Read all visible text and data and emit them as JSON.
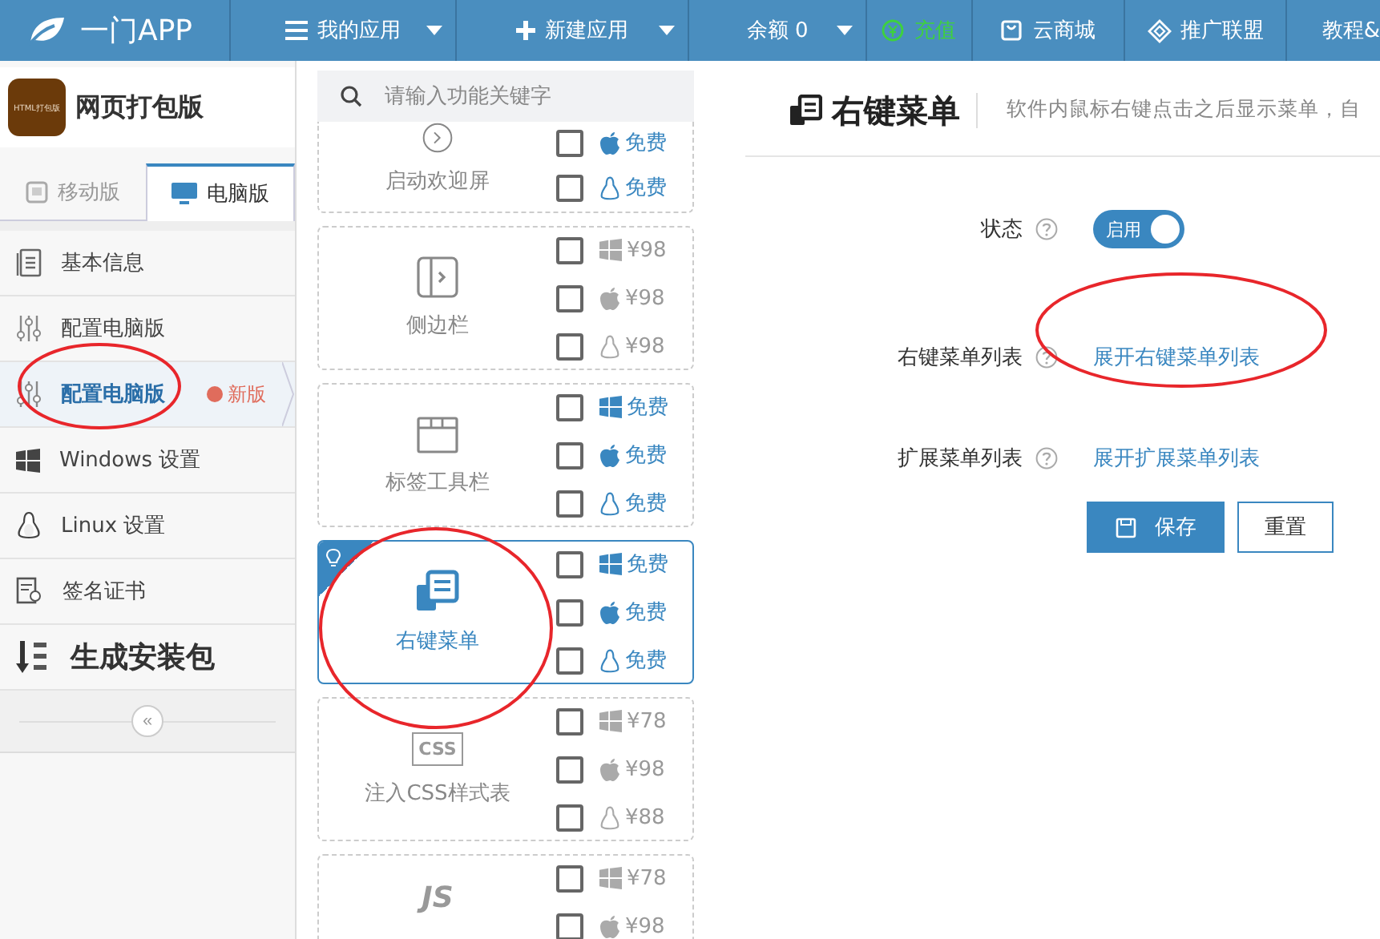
{
  "topbar": {
    "logo": "一门APP",
    "menus": [
      {
        "label": "我的应用",
        "kind": "plain",
        "dropdown": true
      },
      {
        "label": "新建应用",
        "kind": "plain",
        "dropdown": true
      },
      {
        "label": "余额 0",
        "kind": "plain",
        "dropdown": true
      },
      {
        "label": "充值",
        "kind": "accent",
        "dropdown": false
      },
      {
        "label": "云商城",
        "kind": "plain",
        "dropdown": false
      },
      {
        "label": "推广联盟",
        "kind": "plain",
        "dropdown": false
      },
      {
        "label": "教程&",
        "kind": "plain",
        "dropdown": false
      }
    ]
  },
  "sidebar": {
    "app": {
      "logo_text": "HTML打包版",
      "name": "网页打包版"
    },
    "tabs": [
      {
        "label": "移动版",
        "selected": false
      },
      {
        "label": "电脑版",
        "selected": true
      }
    ],
    "items": [
      {
        "label": "基本信息",
        "kind": "nav",
        "selected": false
      },
      {
        "label": "配置电脑版",
        "kind": "nav",
        "selected": false
      },
      {
        "label": "配置电脑版",
        "kind": "nav",
        "selected": true,
        "badge": "新版"
      },
      {
        "label": "Windows 设置",
        "kind": "nav",
        "selected": false
      },
      {
        "label": "Linux 设置",
        "kind": "nav",
        "selected": false
      },
      {
        "label": "签名证书",
        "kind": "nav",
        "selected": false
      },
      {
        "label": "生成安装包",
        "kind": "action",
        "selected": false
      }
    ],
    "collapse": "«"
  },
  "features": {
    "search": {
      "placeholder": "请输入功能关键字"
    },
    "cards": [
      {
        "name": "启动欢迎屏",
        "selected": false,
        "platforms": [
          {
            "kind": "mac",
            "price": "免费",
            "free": true,
            "checked": false
          },
          {
            "kind": "linux",
            "price": "免费",
            "free": true,
            "checked": false
          }
        ]
      },
      {
        "name": "侧边栏",
        "selected": false,
        "platforms": [
          {
            "kind": "windows",
            "price": "¥98",
            "free": false,
            "checked": false
          },
          {
            "kind": "mac",
            "price": "¥98",
            "free": false,
            "checked": false
          },
          {
            "kind": "linux",
            "price": "¥98",
            "free": false,
            "checked": false
          }
        ]
      },
      {
        "name": "标签工具栏",
        "selected": false,
        "platforms": [
          {
            "kind": "windows",
            "price": "免费",
            "free": true,
            "checked": false
          },
          {
            "kind": "mac",
            "price": "免费",
            "free": true,
            "checked": false
          },
          {
            "kind": "linux",
            "price": "免费",
            "free": true,
            "checked": false
          }
        ]
      },
      {
        "name": "右键菜单",
        "selected": true,
        "platforms": [
          {
            "kind": "windows",
            "price": "免费",
            "free": true,
            "checked": false
          },
          {
            "kind": "mac",
            "price": "免费",
            "free": true,
            "checked": false
          },
          {
            "kind": "linux",
            "price": "免费",
            "free": true,
            "checked": false
          }
        ]
      },
      {
        "name": "注入CSS样式表",
        "icon_text": "CSS",
        "selected": false,
        "platforms": [
          {
            "kind": "windows",
            "price": "¥78",
            "free": false,
            "checked": false
          },
          {
            "kind": "mac",
            "price": "¥98",
            "free": false,
            "checked": false
          },
          {
            "kind": "linux",
            "price": "¥88",
            "free": false,
            "checked": false
          }
        ]
      },
      {
        "icon_text": "JS",
        "selected": false,
        "platforms": [
          {
            "kind": "windows",
            "price": "¥78",
            "free": false,
            "checked": false
          },
          {
            "kind": "mac",
            "price": "¥98",
            "free": false,
            "checked": false
          }
        ]
      }
    ]
  },
  "panel": {
    "title": "右键菜单",
    "description": "软件内鼠标右键点击之后显示菜单，自",
    "fields": [
      {
        "label": "状态",
        "kind": "toggle",
        "on": true,
        "value": "启用"
      },
      {
        "label": "右键菜单列表",
        "kind": "link",
        "value": "展开右键菜单列表"
      },
      {
        "label": "扩展菜单列表",
        "kind": "link",
        "value": "展开扩展菜单列表"
      }
    ],
    "buttons": [
      {
        "label": "保存",
        "kind": "primary"
      },
      {
        "label": "重置",
        "kind": "secondary"
      }
    ]
  }
}
